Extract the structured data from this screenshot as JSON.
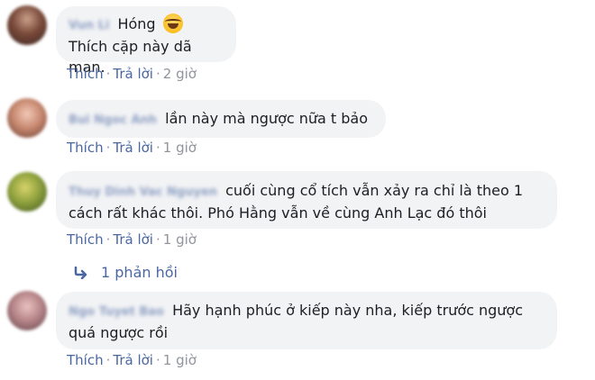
{
  "comments": [
    {
      "author": "Vun Li",
      "text_line1": "Hóng",
      "text_line2": "Thích cặp này dã man.",
      "emoji": "laughing-tears-emoji",
      "like_label": "Thích",
      "reply_label": "Trả lời",
      "time": "2 giờ"
    },
    {
      "author": "Bui Ngoc Anh",
      "text_line1": "lần này mà ngược nữa t bảo",
      "like_label": "Thích",
      "reply_label": "Trả lời",
      "time": "1 giờ"
    },
    {
      "author": "Thuy Dinh Vac Nguyen",
      "text_line1": "cuối cùng cổ tích vẫn xảy ra chỉ là theo 1",
      "text_line2": "cách rất khác thôi. Phó Hằng vẫn về cùng Anh Lạc đó thôi",
      "like_label": "Thích",
      "reply_label": "Trả lời",
      "time": "1 giờ",
      "replies_label": "1 phản hồi"
    },
    {
      "author": "Ngo Tuyet Bao",
      "text_line1": "Hãy hạnh phúc ở kiếp này nha, kiếp trước ngược",
      "text_line2": "quá ngược rồi",
      "like_label": "Thích",
      "reply_label": "Trả lời",
      "time": "1 giờ"
    }
  ],
  "colors": {
    "bubble": "#f2f3f5",
    "link": "#4b67a1",
    "meta": "#90949c",
    "text": "#1c1e21"
  }
}
